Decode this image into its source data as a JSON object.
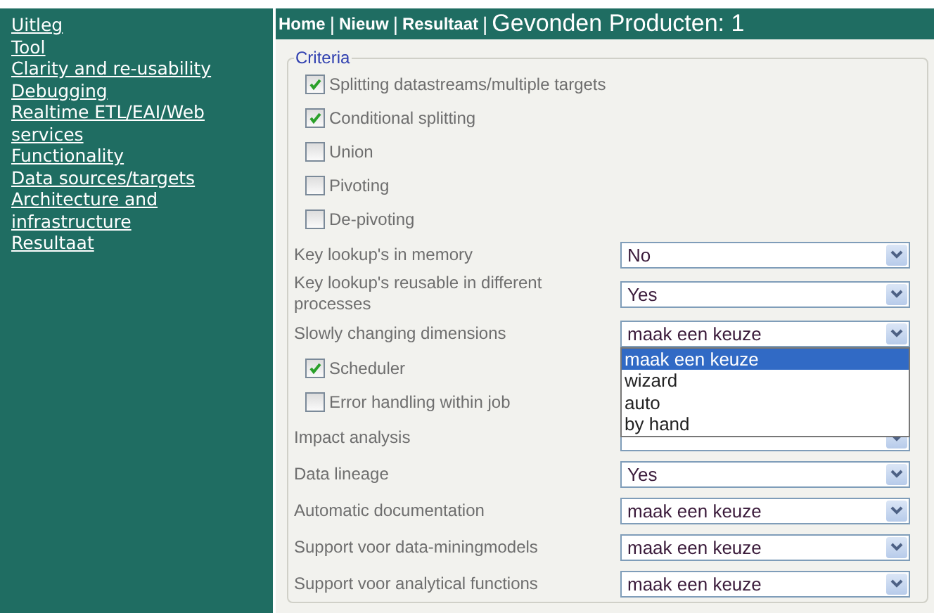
{
  "sidebar": {
    "items": [
      {
        "label": "Uitleg"
      },
      {
        "label": "Tool"
      },
      {
        "label": "Clarity and re-usability"
      },
      {
        "label": "Debugging"
      },
      {
        "label": "Realtime ETL/EAI/Web services"
      },
      {
        "label": "Functionality"
      },
      {
        "label": "Data sources/targets"
      },
      {
        "label": "Architecture and infrastructure"
      },
      {
        "label": "Resultaat"
      }
    ]
  },
  "header": {
    "links": [
      "Home",
      "Nieuw",
      "Resultaat"
    ],
    "separator": "|",
    "title": "Gevonden Producten: 1"
  },
  "criteria": {
    "legend": "Criteria",
    "rows": [
      {
        "kind": "checkbox",
        "label": "Splitting datastreams/multiple targets",
        "checked": true
      },
      {
        "kind": "checkbox",
        "label": "Conditional splitting",
        "checked": true
      },
      {
        "kind": "checkbox",
        "label": "Union",
        "checked": false
      },
      {
        "kind": "checkbox",
        "label": "Pivoting",
        "checked": false
      },
      {
        "kind": "checkbox",
        "label": "De-pivoting",
        "checked": false
      },
      {
        "kind": "select",
        "label": "Key lookup's in memory",
        "value": "No"
      },
      {
        "kind": "select",
        "label": "Key lookup's reusable in different processes",
        "value": "Yes"
      },
      {
        "kind": "select",
        "label": "Slowly changing dimensions",
        "value": "maak een keuze",
        "expanded": true,
        "options": [
          {
            "label": "maak een keuze",
            "selected": true
          },
          {
            "label": "wizard",
            "selected": false
          },
          {
            "label": "auto",
            "selected": false
          },
          {
            "label": "by hand",
            "selected": false
          }
        ]
      },
      {
        "kind": "checkbox",
        "label": "Scheduler",
        "checked": true
      },
      {
        "kind": "checkbox",
        "label": "Error handling within job",
        "checked": false
      },
      {
        "kind": "select",
        "label": "Impact analysis"
      },
      {
        "kind": "select",
        "label": "Data lineage",
        "value": "Yes"
      },
      {
        "kind": "select",
        "label": "Automatic documentation",
        "value": "maak een keuze"
      },
      {
        "kind": "select",
        "label": "Support voor data-miningmodels",
        "value": "maak een keuze"
      },
      {
        "kind": "select",
        "label": "Support voor analytical functions",
        "value": "maak een keuze"
      }
    ]
  }
}
